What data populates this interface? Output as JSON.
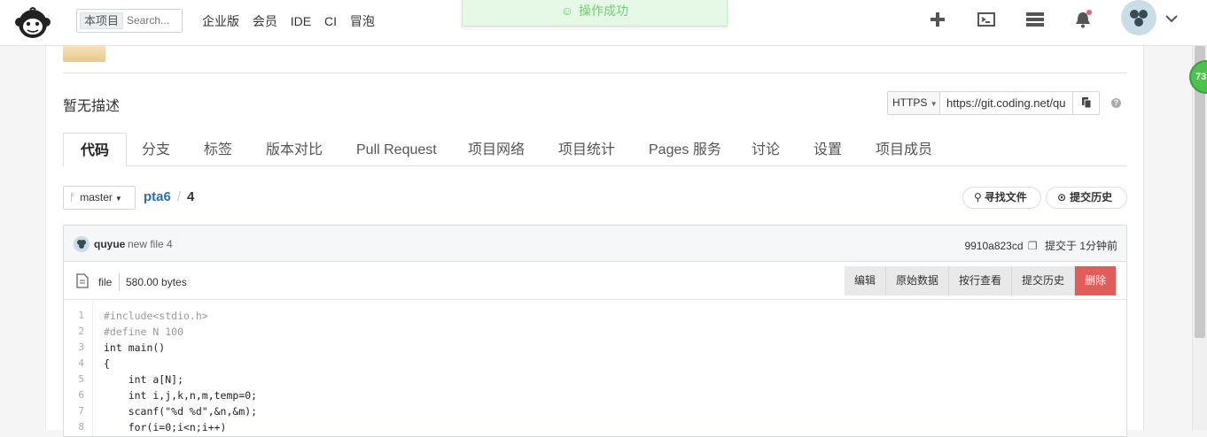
{
  "topbar": {
    "logo_icon": "monkey-logo-icon",
    "project_scope": "本项目",
    "search_placeholder": "Search...",
    "nav": [
      "企业版",
      "会员",
      "IDE",
      "CI",
      "冒泡"
    ],
    "toast": "操作成功",
    "icons": [
      "plus-icon",
      "terminal-icon",
      "server-icon",
      "bell-icon",
      "avatar",
      "chevron-down-icon"
    ]
  },
  "repo": {
    "description": "暂无描述",
    "clone_protocol": "HTTPS",
    "clone_url": "https://git.coding.net/qu"
  },
  "tabs": [
    "代码",
    "分支",
    "标签",
    "版本对比",
    "Pull Request",
    "项目网络",
    "项目统计",
    "Pages 服务",
    "讨论",
    "设置",
    "项目成员"
  ],
  "branch": "master",
  "breadcrumb": {
    "repo": "pta6",
    "sep": "/",
    "file": "4"
  },
  "buttons": {
    "find_file": "寻找文件",
    "commit_history": "提交历史"
  },
  "commit": {
    "user": "quyue",
    "message": "new file 4",
    "hash": "9910a823cd",
    "time": "提交于 1分钟前"
  },
  "file": {
    "type": "file",
    "size": "580.00 bytes",
    "actions": [
      "编辑",
      "原始数据",
      "按行查看",
      "提交历史",
      "删除"
    ]
  },
  "code_lines": [
    "#include<stdio.h>",
    "#define N 100",
    "int main()",
    "{",
    "    int a[N];",
    "    int i,j,k,n,m,temp=0;",
    "    scanf(\"%d %d\",&n,&m);",
    "    for(i=0;i<n;i++)"
  ],
  "line_numbers": [
    "1",
    "2",
    "3",
    "4",
    "5",
    "6",
    "7",
    "8"
  ],
  "side_badge": "73",
  "colors": {
    "accent": "#2f6dab",
    "danger": "#e05d5a",
    "toast_text": "#6fcf6f"
  }
}
